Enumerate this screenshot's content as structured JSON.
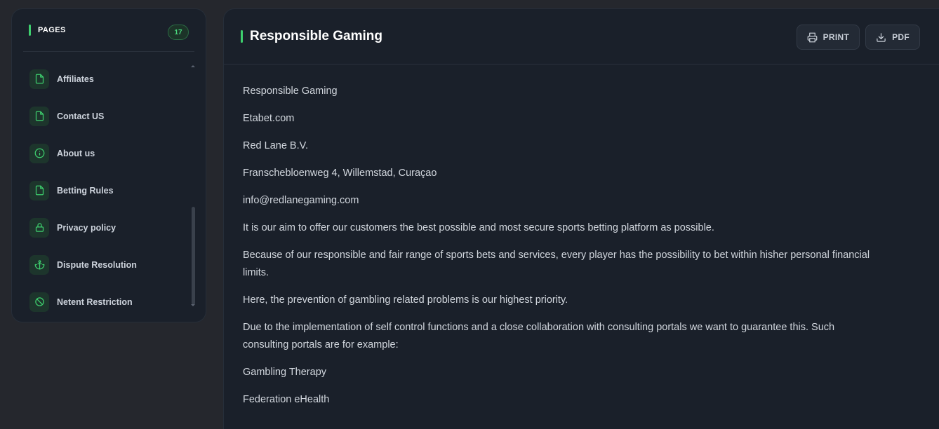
{
  "sidebar": {
    "title": "PAGES",
    "count": "17",
    "items": [
      {
        "label": "Affiliates",
        "icon": "document-icon"
      },
      {
        "label": "Contact US",
        "icon": "document-icon"
      },
      {
        "label": "About us",
        "icon": "info-icon"
      },
      {
        "label": "Betting Rules",
        "icon": "document-icon"
      },
      {
        "label": "Privacy policy",
        "icon": "lock-icon"
      },
      {
        "label": "Dispute Resolution",
        "icon": "anchor-icon"
      },
      {
        "label": "Netent Restriction",
        "icon": "ban-icon"
      }
    ]
  },
  "main": {
    "title": "Responsible Gaming",
    "print_label": "PRINT",
    "pdf_label": "PDF",
    "paragraphs": [
      "Responsible Gaming",
      "Etabet.com",
      "Red Lane B.V.",
      "Franschebloenweg 4, Willemstad, Curaçao",
      "info@redlanegaming.com",
      "It is our aim to offer our customers the best possible and most secure sports betting platform as possible.",
      "Because of our responsible and fair range of sports bets and services, every player has the possibility to bet within hisher personal financial limits.",
      "Here, the prevention of gambling related problems is our highest priority.",
      "Due to the implementation of self control functions and a close collaboration with consulting portals we want to guarantee this. Such consulting portals are for example:",
      "Gambling Therapy",
      "Federation eHealth"
    ]
  },
  "colors": {
    "accent": "#3ecf6e",
    "panel": "#1a202a",
    "background": "#25272d"
  }
}
